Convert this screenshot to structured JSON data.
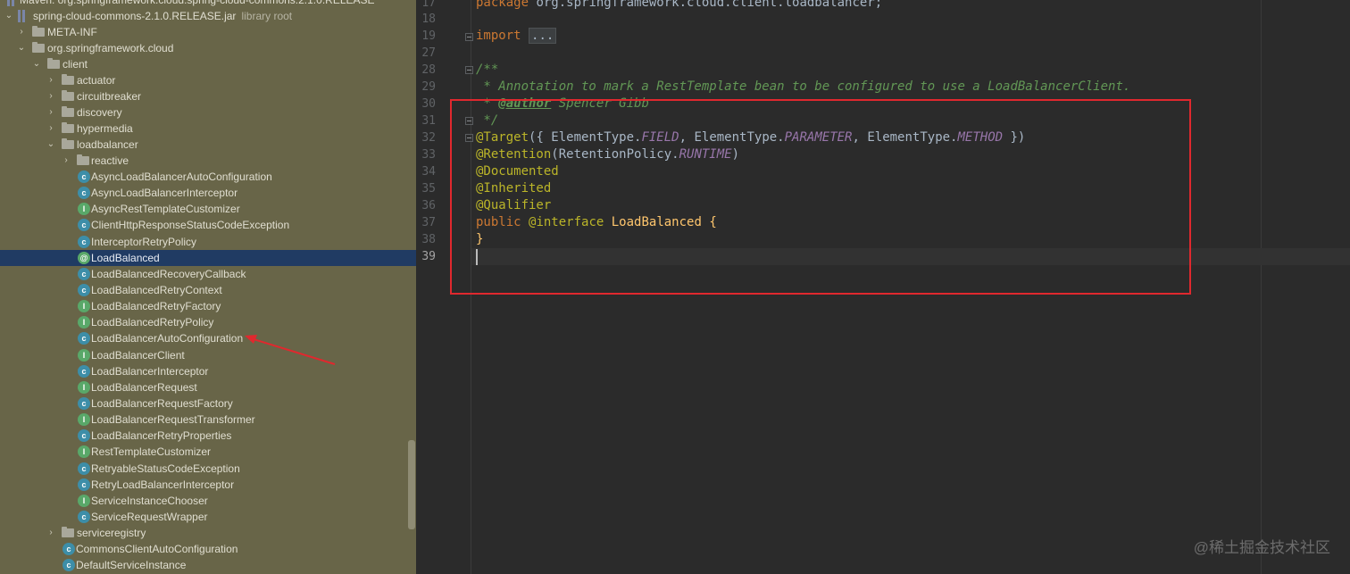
{
  "project_tree": {
    "truncated_root": "Maven: org.springframework.cloud:spring-cloud-commons:2.1.0.RELEASE",
    "jar": {
      "label": "spring-cloud-commons-2.1.0.RELEASE.jar",
      "suffix": "library root"
    },
    "meta_inf": "META-INF",
    "package_root": "org.springframework.cloud",
    "client": "client",
    "client_children": [
      "actuator",
      "circuitbreaker",
      "discovery",
      "hypermedia"
    ],
    "loadbalancer": "loadbalancer",
    "reactive": "reactive",
    "classes": [
      {
        "name": "AsyncLoadBalancerAutoConfiguration",
        "icon": "class-icon",
        "glyph": "c"
      },
      {
        "name": "AsyncLoadBalancerInterceptor",
        "icon": "class-icon",
        "glyph": "c"
      },
      {
        "name": "AsyncRestTemplateCustomizer",
        "icon": "interface-icon",
        "glyph": "I"
      },
      {
        "name": "ClientHttpResponseStatusCodeException",
        "icon": "class-icon",
        "glyph": "c"
      },
      {
        "name": "InterceptorRetryPolicy",
        "icon": "class-icon",
        "glyph": "c"
      },
      {
        "name": "LoadBalanced",
        "icon": "annotation-icon",
        "glyph": "@"
      },
      {
        "name": "LoadBalancedRecoveryCallback",
        "icon": "class-icon",
        "glyph": "c"
      },
      {
        "name": "LoadBalancedRetryContext",
        "icon": "class-icon",
        "glyph": "c"
      },
      {
        "name": "LoadBalancedRetryFactory",
        "icon": "interface-icon",
        "glyph": "I"
      },
      {
        "name": "LoadBalancedRetryPolicy",
        "icon": "interface-icon",
        "glyph": "I"
      },
      {
        "name": "LoadBalancerAutoConfiguration",
        "icon": "class-icon",
        "glyph": "c"
      },
      {
        "name": "LoadBalancerClient",
        "icon": "interface-icon",
        "glyph": "I"
      },
      {
        "name": "LoadBalancerInterceptor",
        "icon": "class-icon",
        "glyph": "c"
      },
      {
        "name": "LoadBalancerRequest",
        "icon": "interface-icon",
        "glyph": "I"
      },
      {
        "name": "LoadBalancerRequestFactory",
        "icon": "class-icon",
        "glyph": "c"
      },
      {
        "name": "LoadBalancerRequestTransformer",
        "icon": "interface-icon",
        "glyph": "I"
      },
      {
        "name": "LoadBalancerRetryProperties",
        "icon": "class-icon",
        "glyph": "c"
      },
      {
        "name": "RestTemplateCustomizer",
        "icon": "interface-icon",
        "glyph": "I"
      },
      {
        "name": "RetryableStatusCodeException",
        "icon": "class-icon",
        "glyph": "c"
      },
      {
        "name": "RetryLoadBalancerInterceptor",
        "icon": "class-icon",
        "glyph": "c"
      },
      {
        "name": "ServiceInstanceChooser",
        "icon": "interface-icon",
        "glyph": "I"
      },
      {
        "name": "ServiceRequestWrapper",
        "icon": "class-icon",
        "glyph": "c"
      }
    ],
    "selected": "LoadBalanced",
    "serviceregistry": "serviceregistry",
    "trailing_classes": [
      {
        "name": "CommonsClientAutoConfiguration",
        "icon": "class-icon",
        "glyph": "c"
      },
      {
        "name": "DefaultServiceInstance",
        "icon": "class-icon",
        "glyph": "c"
      }
    ]
  },
  "editor": {
    "line_numbers": [
      "17",
      "18",
      "19",
      "27",
      "28",
      "29",
      "30",
      "31",
      "32",
      "33",
      "34",
      "35",
      "36",
      "37",
      "38",
      "39"
    ],
    "current_line": "39",
    "code": {
      "package_kw": "package",
      "package_name": " org.springframework.cloud.client.loadbalancer;",
      "import_kw": "import",
      "import_fold": "...",
      "doc_open": "/**",
      "doc_line": " * Annotation to mark a RestTemplate bean to be configured to use a LoadBalancerClient.",
      "doc_author_prefix": " * ",
      "doc_author_tag": "@author",
      "doc_author_name": " Spencer Gibb",
      "doc_close": " */",
      "target_ann": "@Target",
      "target_open": "({ ElementType.",
      "field": "FIELD",
      "sep1": ", ElementType.",
      "parameter": "PARAMETER",
      "sep2": ", ElementType.",
      "method": "METHOD",
      "target_close": " })",
      "retention_ann": "@Retention",
      "retention_open": "(RetentionPolicy.",
      "runtime": "RUNTIME",
      "retention_close": ")",
      "documented": "@Documented",
      "inherited": "@Inherited",
      "qualifier": "@Qualifier",
      "public_kw": "public ",
      "interface_kw": "@interface",
      "type_name": " LoadBalanced {",
      "close_brace": "}"
    }
  },
  "watermark": "@稀土掘金技术社区",
  "colors": {
    "tree_bg": "#686548",
    "editor_bg": "#2b2b2b",
    "selection": "#203b63",
    "highlight_box": "#e0282e",
    "keyword": "#cc7832",
    "annotation": "#bbb529",
    "doc_comment": "#629755",
    "enum_constant": "#9876aa"
  }
}
